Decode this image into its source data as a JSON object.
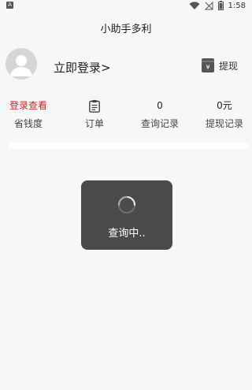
{
  "status_bar": {
    "left_badge": "A",
    "time": "1:58",
    "icons": [
      "wifi-icon",
      "signal-off-icon",
      "battery-icon"
    ]
  },
  "header": {
    "title": "小助手多利"
  },
  "profile": {
    "avatar_icon": "user-avatar-icon",
    "login_label": "立即登录>",
    "withdraw_label": "提现",
    "withdraw_icon": "wallet-icon"
  },
  "stats": [
    {
      "top": "登录查看",
      "bottom": "省钱度"
    },
    {
      "top_icon": "order-list-icon",
      "bottom": "订单"
    },
    {
      "top": "0",
      "bottom": "查询记录"
    },
    {
      "top": "0元",
      "bottom": "提现记录"
    }
  ],
  "toast": {
    "text": "查询中..",
    "icon": "loading-spinner-icon"
  },
  "colors": {
    "accent_red": "#c62828",
    "toast_bg": "#4a4a4a",
    "page_bg": "#f7f7f7"
  }
}
